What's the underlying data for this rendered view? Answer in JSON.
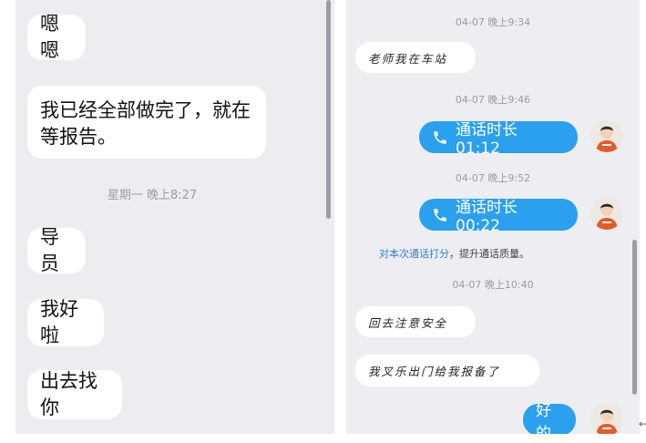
{
  "left": {
    "messages": [
      {
        "text": "嗯嗯"
      },
      {
        "text": "我已经全部做完了，就在等报告。"
      },
      {
        "text": "导员"
      },
      {
        "text": "我好啦"
      },
      {
        "text": "出去找你"
      }
    ],
    "timestamp": "星期一 晚上8:27"
  },
  "right": {
    "timestamps": [
      "04-07 晚上9:34",
      "04-07 晚上9:46",
      "04-07 晚上9:52",
      "04-07 晚上10:40"
    ],
    "messages": {
      "m1": "老师我在车站",
      "call1": "通话时长 01:12",
      "call2": "通话时长 00:22",
      "m2": "回去注意安全",
      "m3": "我叉乐出门给我报备了",
      "reply": "好的"
    },
    "rate": {
      "link": "对本次通话打分",
      "rest": "，提升通话质量。"
    }
  },
  "colors": {
    "bubble_blue": "#2aa0ee",
    "link_blue": "#2b7fd8",
    "background": "#ededf1"
  },
  "icons": [
    "phone-icon",
    "avatar-icon",
    "scrollbar"
  ]
}
